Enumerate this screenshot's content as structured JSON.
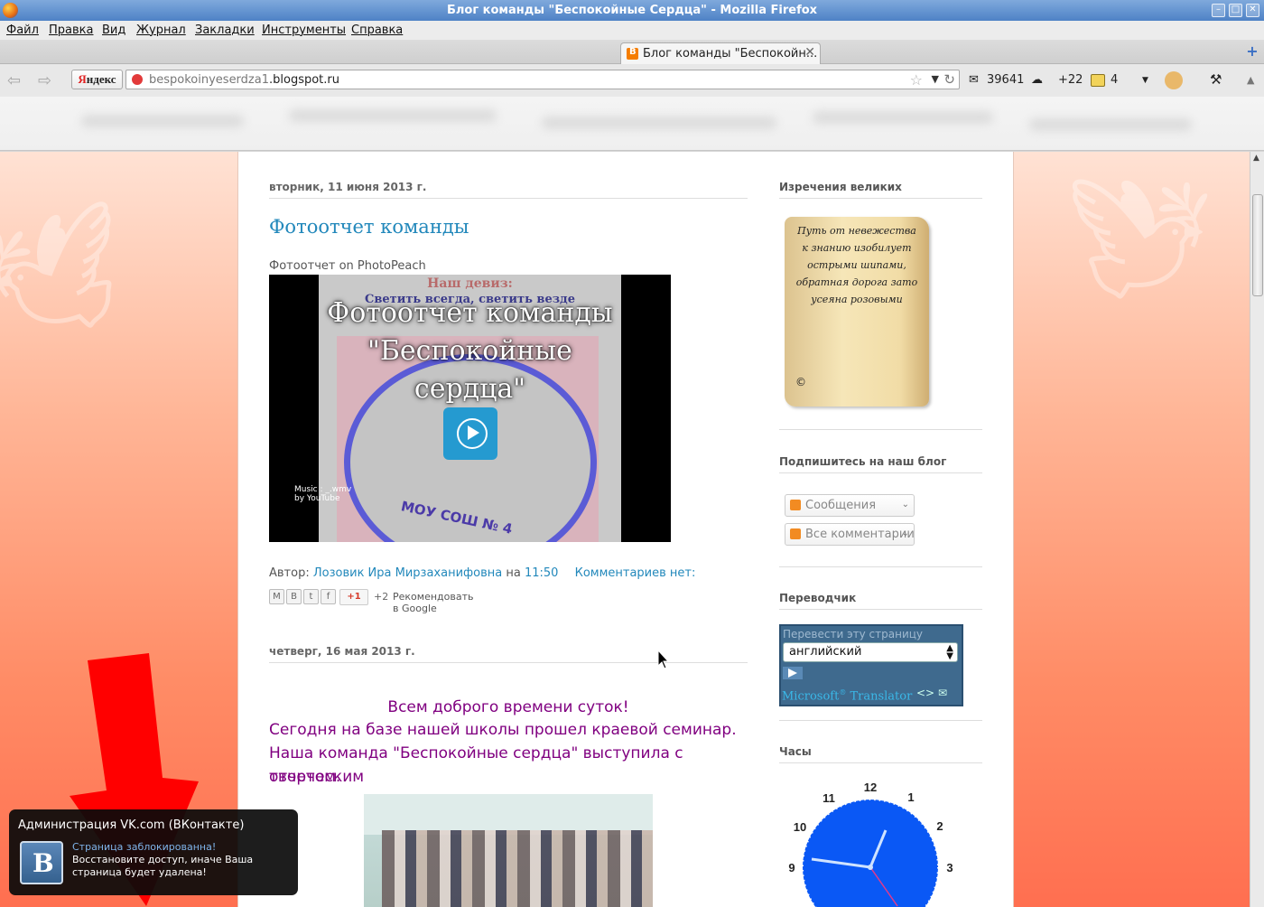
{
  "window": {
    "title": "Блог команды \"Беспокойные Сердца\" - Mozilla Firefox"
  },
  "menu": [
    "Файл",
    "Правка",
    "Вид",
    "Журнал",
    "Закладки",
    "Инструменты",
    "Справка"
  ],
  "tab": {
    "label": "Блог команды \"Беспокойн...",
    "close": "✕",
    "new_tab": "+"
  },
  "toolbar": {
    "yandex_y": "Я",
    "yandex_rest": "ндекс",
    "url_domain_prefix": "bespokoinyeserdza1",
    "url_domain_suffix": ".blogspot.ru",
    "mail_count": "39641",
    "weather": "+22",
    "cards_count": "4"
  },
  "posts": [
    {
      "date": "вторник, 11 июня 2013 г.",
      "title": "Фотоотчет команды",
      "embed_label": "Фотоотчет on PhotoPeach",
      "video": {
        "motto": "Наш девиз:",
        "motto_line": "Светить всегда, светить везде",
        "title_line1": "Фотоотчет команды",
        "title_line2": "\"Беспокойные",
        "title_line3": "сердца\"",
        "school": "МОУ СОШ № 4",
        "music_line1": "Music : _.wmv",
        "music_line2": "by YouTube"
      },
      "byline_prefix": "Автор:",
      "author": "Лозовик Ира Мирзаханифовна",
      "at": "на",
      "time": "11:50",
      "comments": "Комментариев нет:",
      "share": {
        "plus_one": "+1",
        "count": "+2",
        "recommend": "Рекомендовать в Google"
      }
    },
    {
      "date": "четверг, 16 мая 2013 г.",
      "greeting": "Всем доброго времени суток!",
      "line1": "Сегодня на базе нашей школы прошел краевой семинар.",
      "line2": "Наша команда \"Беспокойные сердца\" выступила с творческим",
      "line3": "отчетом."
    }
  ],
  "sidebar": {
    "quotes": {
      "heading": "Изречения великих",
      "quote": "Путь от невежества к знанию изобилует острыми шипами, обратная дорога зато усеяна розовыми",
      "copyright": "©"
    },
    "subscribe": {
      "heading": "Подпишитесь на наш блог",
      "feeds": [
        "Сообщения",
        "Все комментарии"
      ]
    },
    "translator": {
      "heading": "Переводчик",
      "header_text": "Перевести эту страницу",
      "language": "английский",
      "brand": "Microsoft",
      "brand_sup": "®",
      "brand_suffix": "Translator"
    },
    "clock": {
      "heading": "Часы",
      "numbers": [
        "12",
        "1",
        "2",
        "3",
        "9",
        "10",
        "11"
      ]
    }
  },
  "vk_popup": {
    "title": "Администрация VK.com (ВКонтакте)",
    "headline": "Страница заблокированна!",
    "body": "Восстановите доступ, иначе Ваша страница будет удалена!",
    "logo_letter": "B"
  },
  "colors": {
    "link": "#2288bb",
    "post_purple": "#800080",
    "arrow_red": "#ff0000",
    "clock_blue": "#0a58f5"
  }
}
